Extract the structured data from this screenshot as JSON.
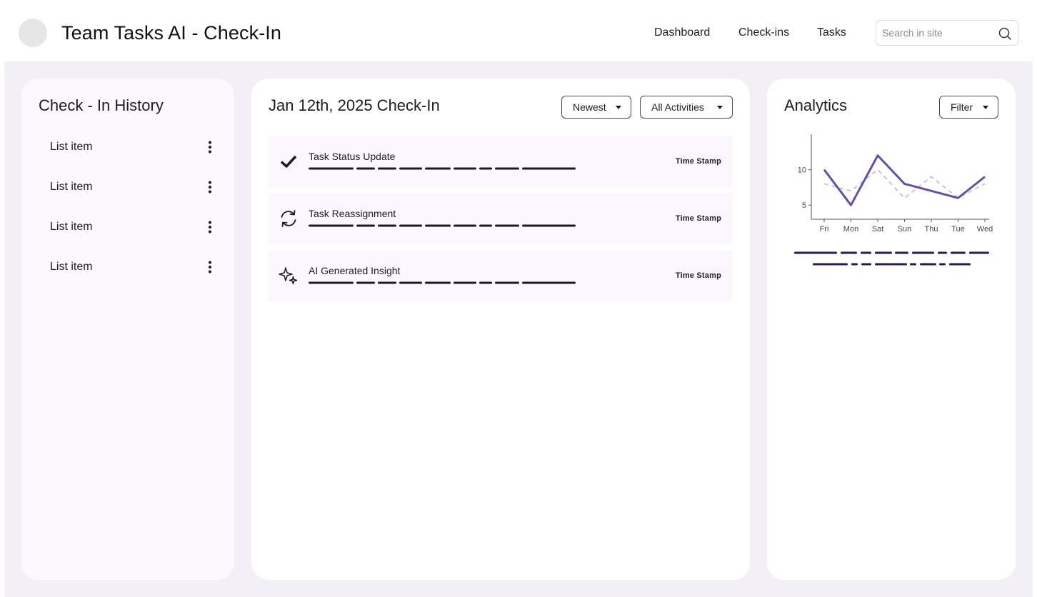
{
  "header": {
    "title": "Team Tasks AI - Check-In",
    "nav": [
      "Dashboard",
      "Check-ins",
      "Tasks"
    ],
    "search_placeholder": "Search in site"
  },
  "history": {
    "title": "Check - In History",
    "items": [
      {
        "label": "List item"
      },
      {
        "label": "List item"
      },
      {
        "label": "List item"
      },
      {
        "label": "List item"
      }
    ]
  },
  "checkin": {
    "title": "Jan 12th, 2025 Check-In",
    "sort_label": "Newest",
    "filter_label": "All Activities",
    "activities": [
      {
        "icon": "check-icon",
        "title": "Task Status Update",
        "time": "Time Stamp"
      },
      {
        "icon": "refresh-icon",
        "title": "Task Reassignment",
        "time": "Time Stamp"
      },
      {
        "icon": "sparkle-icon",
        "title": "AI Generated Insight",
        "time": "Time Stamp"
      }
    ]
  },
  "analytics": {
    "title": "Analytics",
    "filter_label": "Filter"
  },
  "colors": {
    "background": "#f3eff7",
    "card_tint": "#fdf8fe",
    "accent": "#6750a4",
    "accent_light": "#cbbff0",
    "placeholder_line": "#1d1b20",
    "legend_line": "#2a1a56"
  },
  "chart_data": {
    "type": "line",
    "categories": [
      "Fri",
      "Mon",
      "Sat",
      "Sun",
      "Thu",
      "Tue",
      "Wed"
    ],
    "y_ticks": [
      5,
      10
    ],
    "ylim": [
      3,
      15
    ],
    "series": [
      {
        "values": [
          10,
          5,
          12,
          8,
          7,
          6,
          9
        ],
        "style": "solid",
        "color": "#6750a4"
      },
      {
        "values": [
          8,
          7,
          10,
          6,
          9,
          6,
          8
        ],
        "style": "dashed",
        "color": "#cbbff0"
      }
    ]
  }
}
